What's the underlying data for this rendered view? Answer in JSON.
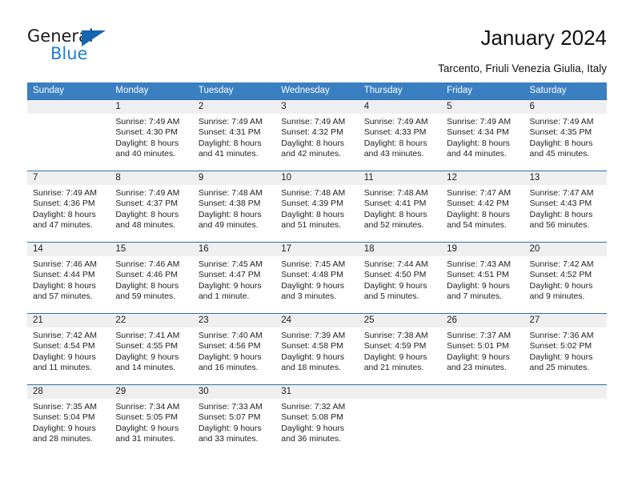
{
  "brand": {
    "name_part1": "General",
    "name_part2": "Blue",
    "triangle_color": "#1565b0",
    "blue_color": "#1f7fd0"
  },
  "header": {
    "title": "January 2024",
    "subtitle": "Tarcento, Friuli Venezia Giulia, Italy"
  },
  "theme": {
    "header_row_bg": "#3a7fc1",
    "header_row_text": "#ffffff",
    "week_divider": "#2f6faf",
    "daynum_bg": "#efefef"
  },
  "weekdays": [
    "Sunday",
    "Monday",
    "Tuesday",
    "Wednesday",
    "Thursday",
    "Friday",
    "Saturday"
  ],
  "weeks": [
    [
      {
        "day": "",
        "sunrise": "",
        "sunset": "",
        "daylight1": "",
        "daylight2": ""
      },
      {
        "day": "1",
        "sunrise": "Sunrise: 7:49 AM",
        "sunset": "Sunset: 4:30 PM",
        "daylight1": "Daylight: 8 hours",
        "daylight2": "and 40 minutes."
      },
      {
        "day": "2",
        "sunrise": "Sunrise: 7:49 AM",
        "sunset": "Sunset: 4:31 PM",
        "daylight1": "Daylight: 8 hours",
        "daylight2": "and 41 minutes."
      },
      {
        "day": "3",
        "sunrise": "Sunrise: 7:49 AM",
        "sunset": "Sunset: 4:32 PM",
        "daylight1": "Daylight: 8 hours",
        "daylight2": "and 42 minutes."
      },
      {
        "day": "4",
        "sunrise": "Sunrise: 7:49 AM",
        "sunset": "Sunset: 4:33 PM",
        "daylight1": "Daylight: 8 hours",
        "daylight2": "and 43 minutes."
      },
      {
        "day": "5",
        "sunrise": "Sunrise: 7:49 AM",
        "sunset": "Sunset: 4:34 PM",
        "daylight1": "Daylight: 8 hours",
        "daylight2": "and 44 minutes."
      },
      {
        "day": "6",
        "sunrise": "Sunrise: 7:49 AM",
        "sunset": "Sunset: 4:35 PM",
        "daylight1": "Daylight: 8 hours",
        "daylight2": "and 45 minutes."
      }
    ],
    [
      {
        "day": "7",
        "sunrise": "Sunrise: 7:49 AM",
        "sunset": "Sunset: 4:36 PM",
        "daylight1": "Daylight: 8 hours",
        "daylight2": "and 47 minutes."
      },
      {
        "day": "8",
        "sunrise": "Sunrise: 7:49 AM",
        "sunset": "Sunset: 4:37 PM",
        "daylight1": "Daylight: 8 hours",
        "daylight2": "and 48 minutes."
      },
      {
        "day": "9",
        "sunrise": "Sunrise: 7:48 AM",
        "sunset": "Sunset: 4:38 PM",
        "daylight1": "Daylight: 8 hours",
        "daylight2": "and 49 minutes."
      },
      {
        "day": "10",
        "sunrise": "Sunrise: 7:48 AM",
        "sunset": "Sunset: 4:39 PM",
        "daylight1": "Daylight: 8 hours",
        "daylight2": "and 51 minutes."
      },
      {
        "day": "11",
        "sunrise": "Sunrise: 7:48 AM",
        "sunset": "Sunset: 4:41 PM",
        "daylight1": "Daylight: 8 hours",
        "daylight2": "and 52 minutes."
      },
      {
        "day": "12",
        "sunrise": "Sunrise: 7:47 AM",
        "sunset": "Sunset: 4:42 PM",
        "daylight1": "Daylight: 8 hours",
        "daylight2": "and 54 minutes."
      },
      {
        "day": "13",
        "sunrise": "Sunrise: 7:47 AM",
        "sunset": "Sunset: 4:43 PM",
        "daylight1": "Daylight: 8 hours",
        "daylight2": "and 56 minutes."
      }
    ],
    [
      {
        "day": "14",
        "sunrise": "Sunrise: 7:46 AM",
        "sunset": "Sunset: 4:44 PM",
        "daylight1": "Daylight: 8 hours",
        "daylight2": "and 57 minutes."
      },
      {
        "day": "15",
        "sunrise": "Sunrise: 7:46 AM",
        "sunset": "Sunset: 4:46 PM",
        "daylight1": "Daylight: 8 hours",
        "daylight2": "and 59 minutes."
      },
      {
        "day": "16",
        "sunrise": "Sunrise: 7:45 AM",
        "sunset": "Sunset: 4:47 PM",
        "daylight1": "Daylight: 9 hours",
        "daylight2": "and 1 minute."
      },
      {
        "day": "17",
        "sunrise": "Sunrise: 7:45 AM",
        "sunset": "Sunset: 4:48 PM",
        "daylight1": "Daylight: 9 hours",
        "daylight2": "and 3 minutes."
      },
      {
        "day": "18",
        "sunrise": "Sunrise: 7:44 AM",
        "sunset": "Sunset: 4:50 PM",
        "daylight1": "Daylight: 9 hours",
        "daylight2": "and 5 minutes."
      },
      {
        "day": "19",
        "sunrise": "Sunrise: 7:43 AM",
        "sunset": "Sunset: 4:51 PM",
        "daylight1": "Daylight: 9 hours",
        "daylight2": "and 7 minutes."
      },
      {
        "day": "20",
        "sunrise": "Sunrise: 7:42 AM",
        "sunset": "Sunset: 4:52 PM",
        "daylight1": "Daylight: 9 hours",
        "daylight2": "and 9 minutes."
      }
    ],
    [
      {
        "day": "21",
        "sunrise": "Sunrise: 7:42 AM",
        "sunset": "Sunset: 4:54 PM",
        "daylight1": "Daylight: 9 hours",
        "daylight2": "and 11 minutes."
      },
      {
        "day": "22",
        "sunrise": "Sunrise: 7:41 AM",
        "sunset": "Sunset: 4:55 PM",
        "daylight1": "Daylight: 9 hours",
        "daylight2": "and 14 minutes."
      },
      {
        "day": "23",
        "sunrise": "Sunrise: 7:40 AM",
        "sunset": "Sunset: 4:56 PM",
        "daylight1": "Daylight: 9 hours",
        "daylight2": "and 16 minutes."
      },
      {
        "day": "24",
        "sunrise": "Sunrise: 7:39 AM",
        "sunset": "Sunset: 4:58 PM",
        "daylight1": "Daylight: 9 hours",
        "daylight2": "and 18 minutes."
      },
      {
        "day": "25",
        "sunrise": "Sunrise: 7:38 AM",
        "sunset": "Sunset: 4:59 PM",
        "daylight1": "Daylight: 9 hours",
        "daylight2": "and 21 minutes."
      },
      {
        "day": "26",
        "sunrise": "Sunrise: 7:37 AM",
        "sunset": "Sunset: 5:01 PM",
        "daylight1": "Daylight: 9 hours",
        "daylight2": "and 23 minutes."
      },
      {
        "day": "27",
        "sunrise": "Sunrise: 7:36 AM",
        "sunset": "Sunset: 5:02 PM",
        "daylight1": "Daylight: 9 hours",
        "daylight2": "and 25 minutes."
      }
    ],
    [
      {
        "day": "28",
        "sunrise": "Sunrise: 7:35 AM",
        "sunset": "Sunset: 5:04 PM",
        "daylight1": "Daylight: 9 hours",
        "daylight2": "and 28 minutes."
      },
      {
        "day": "29",
        "sunrise": "Sunrise: 7:34 AM",
        "sunset": "Sunset: 5:05 PM",
        "daylight1": "Daylight: 9 hours",
        "daylight2": "and 31 minutes."
      },
      {
        "day": "30",
        "sunrise": "Sunrise: 7:33 AM",
        "sunset": "Sunset: 5:07 PM",
        "daylight1": "Daylight: 9 hours",
        "daylight2": "and 33 minutes."
      },
      {
        "day": "31",
        "sunrise": "Sunrise: 7:32 AM",
        "sunset": "Sunset: 5:08 PM",
        "daylight1": "Daylight: 9 hours",
        "daylight2": "and 36 minutes."
      },
      {
        "day": "",
        "sunrise": "",
        "sunset": "",
        "daylight1": "",
        "daylight2": ""
      },
      {
        "day": "",
        "sunrise": "",
        "sunset": "",
        "daylight1": "",
        "daylight2": ""
      },
      {
        "day": "",
        "sunrise": "",
        "sunset": "",
        "daylight1": "",
        "daylight2": ""
      }
    ]
  ]
}
